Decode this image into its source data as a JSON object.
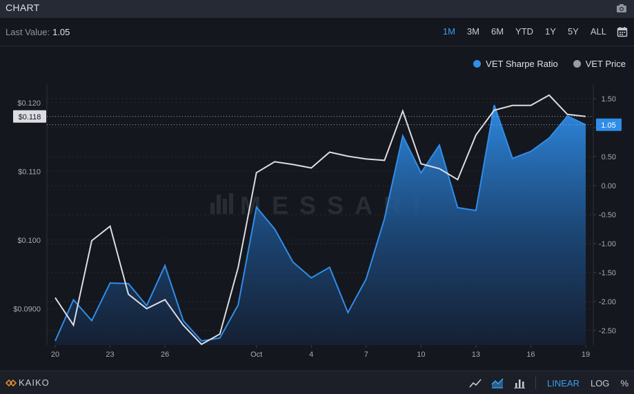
{
  "header": {
    "title": "CHART"
  },
  "toolbar": {
    "last_value_label": "Last Value:",
    "last_value": "1.05",
    "ranges": [
      "1M",
      "3M",
      "6M",
      "YTD",
      "1Y",
      "5Y",
      "ALL"
    ],
    "active_range": "1M"
  },
  "footer": {
    "brand": "KAIKO",
    "scale_options": [
      "LINEAR",
      "LOG",
      "%"
    ],
    "active_scale": "LINEAR"
  },
  "watermark": "MESSARI",
  "colors": {
    "sharpe": "#2f8eea",
    "price": "#dcdde2",
    "accent": "#3a9ef0",
    "background": "#15171e"
  },
  "chart_data": {
    "type": "line",
    "x_ticks": [
      "20",
      "23",
      "26",
      "Oct",
      "4",
      "7",
      "10",
      "13",
      "16",
      "19"
    ],
    "series": [
      {
        "name": "VET Sharpe Ratio",
        "axis": "right",
        "style": "area",
        "values": [
          -2.68,
          -1.97,
          -2.33,
          -1.68,
          -1.69,
          -2.07,
          -1.38,
          -2.33,
          -2.68,
          -2.63,
          -2.06,
          -0.37,
          -0.75,
          -1.32,
          -1.59,
          -1.41,
          -2.19,
          -1.61,
          -0.57,
          0.86,
          0.22,
          0.7,
          -0.38,
          -0.43,
          1.39,
          0.47,
          0.59,
          0.82,
          1.2,
          1.05
        ],
        "last_value": "1.05",
        "ylim": [
          -2.75,
          1.75
        ],
        "ticks": [
          "1.50",
          "1.00",
          "0.50",
          "0.00",
          "-0.50",
          "-1.00",
          "-1.50",
          "-2.00",
          "-2.50"
        ]
      },
      {
        "name": "VET Price",
        "axis": "left",
        "style": "line",
        "values": [
          0.0916,
          0.0876,
          0.0999,
          0.102,
          0.0921,
          0.09,
          0.0913,
          0.0876,
          0.0848,
          0.0863,
          0.096,
          0.1098,
          0.1114,
          0.111,
          0.1105,
          0.1128,
          0.1122,
          0.1118,
          0.1116,
          0.1188,
          0.1111,
          0.1104,
          0.1088,
          0.1153,
          0.1189,
          0.1196,
          0.1196,
          0.1211,
          0.1183,
          0.118
        ],
        "last_value": "$0.118",
        "ylim": [
          0.0847,
          0.1227
        ],
        "ticks": [
          "$0.120",
          "$0.110",
          "$0.100",
          "$0.0900"
        ]
      }
    ],
    "legend_position": "top-right",
    "grid": true
  }
}
